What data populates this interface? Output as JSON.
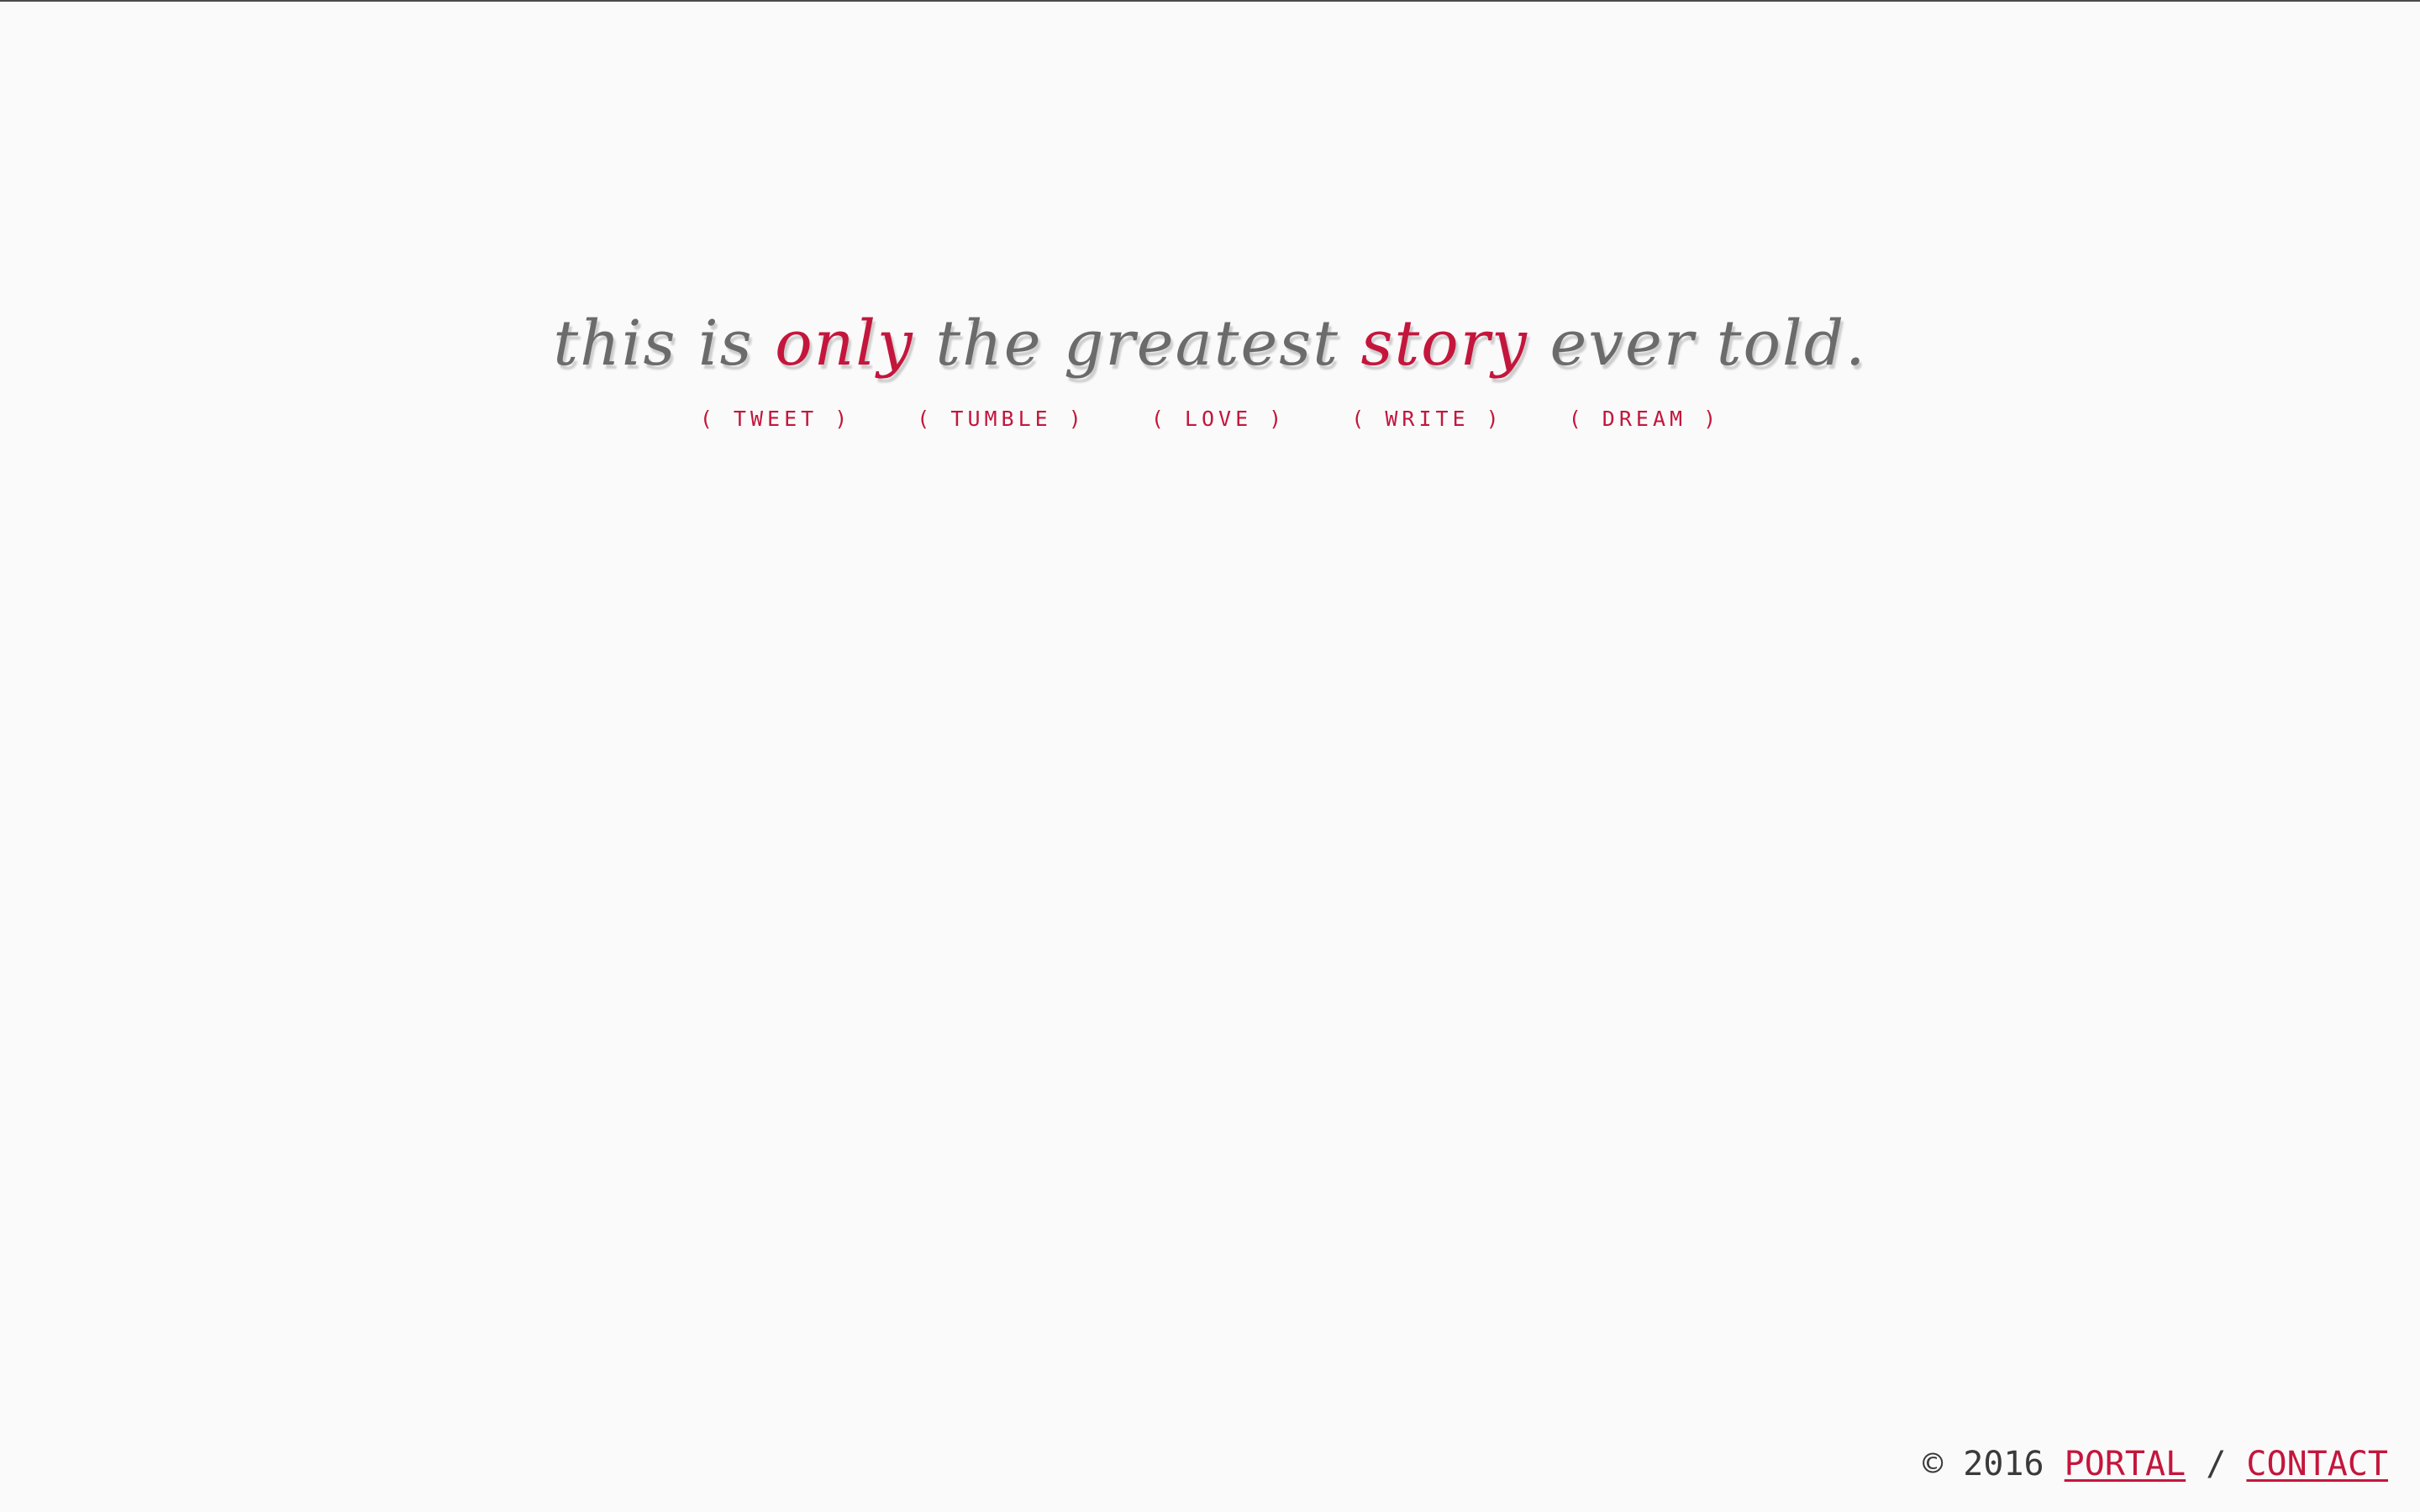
{
  "tagline": {
    "part1": "this is ",
    "accent1": "only",
    "part2": " the greatest ",
    "accent2": "story",
    "part3": " ever told."
  },
  "share_links": [
    {
      "label": "( TWEET )"
    },
    {
      "label": "( TUMBLE )"
    },
    {
      "label": "( LOVE )"
    },
    {
      "label": "( WRITE )"
    },
    {
      "label": "( DREAM )"
    }
  ],
  "footer": {
    "copyright": "© 2016 ",
    "portal_label": "PORTAL",
    "separator": " / ",
    "contact_label": "CONTACT"
  },
  "colors": {
    "accent": "#c4163c",
    "text": "#6b6b6b",
    "background": "#fafafa"
  }
}
